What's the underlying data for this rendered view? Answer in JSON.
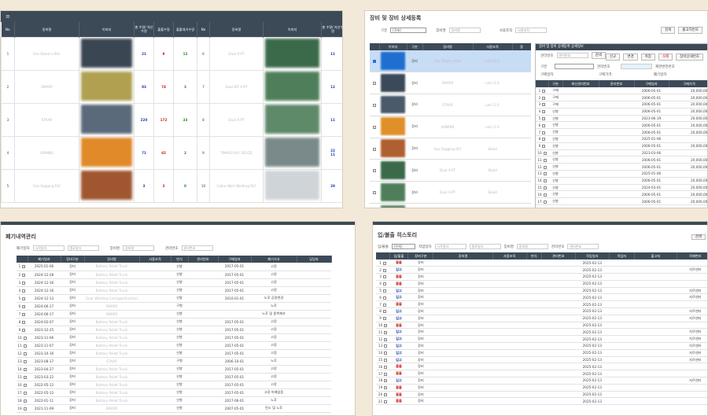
{
  "panel1": {
    "menu": "≡",
    "headers": [
      "No",
      "장비명",
      "이미지",
      "총 수량/\n차산수량",
      "출출수량",
      "출출대기수량",
      "No",
      "장비명",
      "이미지",
      "총 수량/\n자산수량"
    ],
    "left_rows": [
      {
        "no": "1",
        "name": "Gas Steam Lifter",
        "total": "21",
        "out": "9",
        "wait": "12",
        "color": "#3a4652"
      },
      {
        "no": "2",
        "name": "SMARP",
        "total": "83",
        "out": "74",
        "wait": "3",
        "color": "#b0a050"
      },
      {
        "no": "3",
        "name": "STAAR",
        "total": "220",
        "out": "172",
        "wait": "33",
        "color": "#5a6a7a"
      },
      {
        "no": "4",
        "name": "ADMINS",
        "total": "71",
        "out": "65",
        "wait": "2",
        "color": "#e08a2a"
      },
      {
        "no": "5",
        "name": "Gas Sagging RLY",
        "total": "3",
        "out": "3",
        "wait": "0",
        "color": "#a0562e"
      }
    ],
    "right_rows": [
      {
        "no": "6",
        "name": "Dual X-PT",
        "total": "11",
        "color": "#3b6a4a"
      },
      {
        "no": "7",
        "name": "Dual WT X-PT",
        "total": "12",
        "color": "#4f7f5a"
      },
      {
        "no": "8",
        "name": "Dual X-PT",
        "total": "11",
        "color": "#5f8a6a"
      },
      {
        "no": "9",
        "name": "TIMASR RLY 1B1IZE",
        "total": "22",
        "total2": "11",
        "color": "#7a8a8a"
      },
      {
        "no": "10",
        "name": "Collar Wort Welding RLY",
        "total": "29",
        "color": "#cfd4d8"
      }
    ]
  },
  "panel2": {
    "title": "장비 및 장비 상세등록",
    "filter_labels": [
      "구분",
      "장비명",
      "사용조직"
    ],
    "filter_select": "[전체]",
    "filter_placeholder": "장비명",
    "filter_placeholder2": "사용조직",
    "buttons": [
      "검색",
      "출고지번호"
    ],
    "headers": [
      "",
      "이미지",
      "구분",
      "장비명",
      "사용조직",
      "중"
    ],
    "rows": [
      {
        "type": "장비",
        "name": "Gas Steam Lifter",
        "org": "Lelcl 2.0",
        "color": "#1f6fd0"
      },
      {
        "type": "장비",
        "name": "SMARP",
        "org": "Lelcl 2.0",
        "color": "#3a4a5a"
      },
      {
        "type": "장비",
        "name": "STAAR",
        "org": "Lelcl 2.0",
        "color": "#4a5a6a"
      },
      {
        "type": "장비",
        "name": "ADMINS",
        "org": "Lelcl 2.0",
        "color": "#e0902a"
      },
      {
        "type": "장비",
        "name": "Gas Sagging RLY",
        "org": "Sbold",
        "color": "#b06030"
      },
      {
        "type": "장비",
        "name": "Dual X-PT",
        "org": "Sbold",
        "color": "#3b6a4a"
      },
      {
        "type": "장비",
        "name": "Dual X-PT",
        "org": "Sbold",
        "color": "#4f7f5a"
      },
      {
        "type": "장비",
        "name": "Dual WT X-PT",
        "org": "Sbold",
        "color": "#5f8a6a"
      }
    ],
    "inner": {
      "head": "장비 및 장비 상세등록 상세정보",
      "label1": "관리번호",
      "placeholder1": "관리번호",
      "btn_search": "검색",
      "buttons": [
        "신규",
        "변경",
        "취장",
        "삭제",
        "장비상세번호"
      ],
      "form_labels": [
        "구분",
        "관리번호",
        "재관변관번호",
        "구매일자",
        "구매가격",
        "폐기일자"
      ],
      "headers": [
        "",
        "구분",
        "최신관리번호",
        "관리번호",
        "구매일자",
        "구매가격"
      ],
      "rows": [
        {
          "no": "1",
          "type": "구매",
          "date": "2006-05-01",
          "price": "20,000,000"
        },
        {
          "no": "2",
          "type": "구매",
          "date": "2006-05-01",
          "price": "20,000,000"
        },
        {
          "no": "3",
          "type": "구매",
          "date": "2006-05-01",
          "price": "20,000,000"
        },
        {
          "no": "4",
          "type": "신발",
          "date": "2006-05-01",
          "price": "20,000,000"
        },
        {
          "no": "5",
          "type": "신발",
          "date": "2023-06-19",
          "price": "20,000,000"
        },
        {
          "no": "6",
          "type": "신발",
          "date": "2006-05-01",
          "price": "20,000,000"
        },
        {
          "no": "7",
          "type": "신발",
          "date": "2006-05-01",
          "price": "20,000,000"
        },
        {
          "no": "8",
          "type": "신발",
          "date": "2025-01-06",
          "price": "0"
        },
        {
          "no": "9",
          "type": "신발",
          "date": "2006-05-01",
          "price": "20,000,000"
        },
        {
          "no": "10",
          "type": "신발",
          "date": "2023-03-06",
          "price": "0"
        },
        {
          "no": "11",
          "type": "신발",
          "date": "2006-05-01",
          "price": "20,000,000"
        },
        {
          "no": "12",
          "type": "신발",
          "date": "2006-05-01",
          "price": "20,000,000"
        },
        {
          "no": "13",
          "type": "신발",
          "date": "2025-01-06",
          "price": "0"
        },
        {
          "no": "14",
          "type": "신발",
          "date": "2006-05-01",
          "price": "20,000,000"
        },
        {
          "no": "15",
          "type": "신발",
          "date": "2024-03-01",
          "price": "20,000,000"
        },
        {
          "no": "16",
          "type": "신발",
          "date": "2006-05-01",
          "price": "20,000,000"
        },
        {
          "no": "17",
          "type": "신발",
          "date": "2006-05-01",
          "price": "20,000,000"
        }
      ]
    }
  },
  "panel3": {
    "title": "폐기내역관리",
    "filter_labels": [
      "폐기일자",
      "장비명",
      "관리번호"
    ],
    "placeholders": [
      "시작일자",
      "종료일자",
      "장비명",
      "관리번호"
    ],
    "headers": [
      "",
      "폐기일자",
      "장비구분",
      "장비명",
      "사용조직",
      "연식",
      "관리번호",
      "구매일자",
      "폐기사유",
      "담당자"
    ],
    "rows": [
      {
        "no": "1",
        "date": "2025-01-06",
        "type": "장비",
        "name": "Battery Pallet Truck",
        "year": "신발",
        "buy": "2017-05-01",
        "reason": "고장"
      },
      {
        "no": "2",
        "date": "2024-12-28",
        "type": "장비",
        "name": "Battery Pallet Truck",
        "year": "신발",
        "buy": "2017-05-01",
        "reason": "고장"
      },
      {
        "no": "3",
        "date": "2024-12-16",
        "type": "장비",
        "name": "Battery Pallet Truck",
        "year": "신발",
        "buy": "2017-05-01",
        "reason": "고장"
      },
      {
        "no": "4",
        "date": "2024-12-16",
        "type": "장비",
        "name": "Battery Pallet Truck",
        "year": "신발",
        "buy": "2017-05-01",
        "reason": "고장"
      },
      {
        "no": "5",
        "date": "2024-12-13",
        "type": "장비",
        "name": "Gear Welding Carriage(Granite)",
        "year": "신발",
        "buy": "2010-01-01",
        "reason": "노후 공정변경"
      },
      {
        "no": "6",
        "date": "2024-06-17",
        "type": "장비",
        "name": "SMARP",
        "year": "구형",
        "buy": "",
        "reason": "노후"
      },
      {
        "no": "7",
        "date": "2024-06-17",
        "type": "장비",
        "name": "SMARP",
        "year": "신발",
        "buy": "",
        "reason": "노후 및 중복제조"
      },
      {
        "no": "8",
        "date": "2024-02-07",
        "type": "장비",
        "name": "Battery Pallet Truck",
        "year": "신발",
        "buy": "2017-05-01",
        "reason": "고장"
      },
      {
        "no": "9",
        "date": "2023-12-25",
        "type": "장비",
        "name": "Battery Pallet Truck",
        "year": "신발",
        "buy": "2017-05-01",
        "reason": "고장"
      },
      {
        "no": "10",
        "date": "2023-11-06",
        "type": "장비",
        "name": "Battery Pallet Truck",
        "year": "신발",
        "buy": "2017-05-01",
        "reason": "고장"
      },
      {
        "no": "11",
        "date": "2023-11-07",
        "type": "장비",
        "name": "Battery Pallet Truck",
        "year": "신발",
        "buy": "2017-05-01",
        "reason": "고장"
      },
      {
        "no": "12",
        "date": "2023-10-16",
        "type": "장비",
        "name": "Battery Pallet Truck",
        "year": "신발",
        "buy": "2017-05-01",
        "reason": "고장"
      },
      {
        "no": "13",
        "date": "2023-08-17",
        "type": "장비",
        "name": "STAAR",
        "year": "구형",
        "buy": "2006-10-01",
        "reason": "노후"
      },
      {
        "no": "14",
        "date": "2023-04-27",
        "type": "장비",
        "name": "Battery Pallet Truck",
        "year": "신발",
        "buy": "2017-05-01",
        "reason": "고장"
      },
      {
        "no": "15",
        "date": "2023-03-22",
        "type": "장비",
        "name": "Battery Pallet Truck",
        "year": "신발",
        "buy": "2017-05-01",
        "reason": "고장"
      },
      {
        "no": "16",
        "date": "2022-05-12",
        "type": "장비",
        "name": "Battery Pallet Truck",
        "year": "신발",
        "buy": "2017-05-01",
        "reason": "고장"
      },
      {
        "no": "17",
        "date": "2022-05-12",
        "type": "장비",
        "name": "Battery Pallet Truck",
        "year": "신발",
        "buy": "2017-05-01",
        "reason": "고장 미배없음"
      },
      {
        "no": "18",
        "date": "2022-01-11",
        "type": "장비",
        "name": "Battery Pallet Truck",
        "year": "신발",
        "buy": "2017-06-01",
        "reason": "노후"
      },
      {
        "no": "19",
        "date": "2021-11-09",
        "type": "장비",
        "name": "SMARP",
        "year": "신발",
        "buy": "2007-05-01",
        "reason": "된소 및 노후"
      }
    ]
  },
  "panel4": {
    "title": "입/불출 히스토리",
    "filter_labels": [
      "입/불출",
      "작업일자",
      "장비명",
      "관리번호"
    ],
    "filter_select": "[전체]",
    "placeholders": [
      "시작일자",
      "종료일자",
      "장비명",
      "관리번호"
    ],
    "button": "검색",
    "headers": [
      "",
      "입/불출",
      "장비구분",
      "장비명",
      "사용조직",
      "연식",
      "관리번호",
      "작업일자",
      "작업자",
      "출고처",
      "작폐변리"
    ],
    "rows": [
      {
        "no": "1",
        "io": "불출",
        "cat": "장비",
        "date": "2025-02-13",
        "note": ""
      },
      {
        "no": "2",
        "io": "입고",
        "cat": "장비",
        "date": "2025-02-13",
        "note": "지르센터"
      },
      {
        "no": "3",
        "io": "불출",
        "cat": "장비",
        "date": "2025-02-13",
        "note": ""
      },
      {
        "no": "4",
        "io": "불출",
        "cat": "장비",
        "date": "2025-02-13",
        "note": ""
      },
      {
        "no": "5",
        "io": "입고",
        "cat": "장비",
        "date": "2025-02-13",
        "note": "지르센터"
      },
      {
        "no": "6",
        "io": "입고",
        "cat": "장비",
        "date": "2025-02-13",
        "note": "지르센터"
      },
      {
        "no": "7",
        "io": "불출",
        "cat": "장비",
        "date": "2025-02-13",
        "note": ""
      },
      {
        "no": "8",
        "io": "입고",
        "cat": "장비",
        "date": "2025-02-13",
        "note": "지르센터"
      },
      {
        "no": "9",
        "io": "입고",
        "cat": "장비",
        "date": "2025-02-13",
        "note": "지르센터"
      },
      {
        "no": "10",
        "io": "불출",
        "cat": "장비",
        "date": "2025-02-13",
        "note": ""
      },
      {
        "no": "11",
        "io": "입고",
        "cat": "장비",
        "date": "2025-02-13",
        "note": "지르센터"
      },
      {
        "no": "12",
        "io": "입고",
        "cat": "장비",
        "date": "2025-02-13",
        "note": "지르센터"
      },
      {
        "no": "13",
        "io": "입고",
        "cat": "장비",
        "date": "2025-02-13",
        "note": "지르센터"
      },
      {
        "no": "14",
        "io": "입고",
        "cat": "장비",
        "date": "2025-02-13",
        "note": "지르센터"
      },
      {
        "no": "15",
        "io": "입고",
        "cat": "장비",
        "date": "2025-02-13",
        "note": "지르센터"
      },
      {
        "no": "16",
        "io": "불출",
        "cat": "장비",
        "date": "2025-02-13",
        "note": ""
      },
      {
        "no": "17",
        "io": "불출",
        "cat": "장비",
        "date": "2025-02-13",
        "note": ""
      },
      {
        "no": "18",
        "io": "입고",
        "cat": "장비",
        "date": "2025-02-13",
        "note": "지르센터"
      },
      {
        "no": "19",
        "io": "불출",
        "cat": "장비",
        "date": "2025-02-13",
        "note": ""
      },
      {
        "no": "20",
        "io": "불출",
        "cat": "장비",
        "date": "2025-02-13",
        "note": ""
      },
      {
        "no": "21",
        "io": "불출",
        "cat": "장비",
        "date": "2025-02-13",
        "note": ""
      }
    ]
  }
}
